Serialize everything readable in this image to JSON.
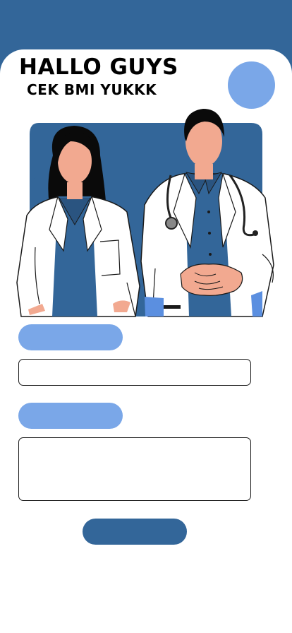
{
  "header": {
    "title": "HALLO GUYS",
    "subtitle": "CEK BMI YUKKK"
  },
  "form": {
    "field1_label": "",
    "field1_value": "",
    "field2_label": "",
    "field2_value": "",
    "submit_label": ""
  },
  "colors": {
    "primary": "#336699",
    "accent": "#7aa7e8",
    "card": "#ffffff"
  },
  "illustration": "doctors-illustration"
}
